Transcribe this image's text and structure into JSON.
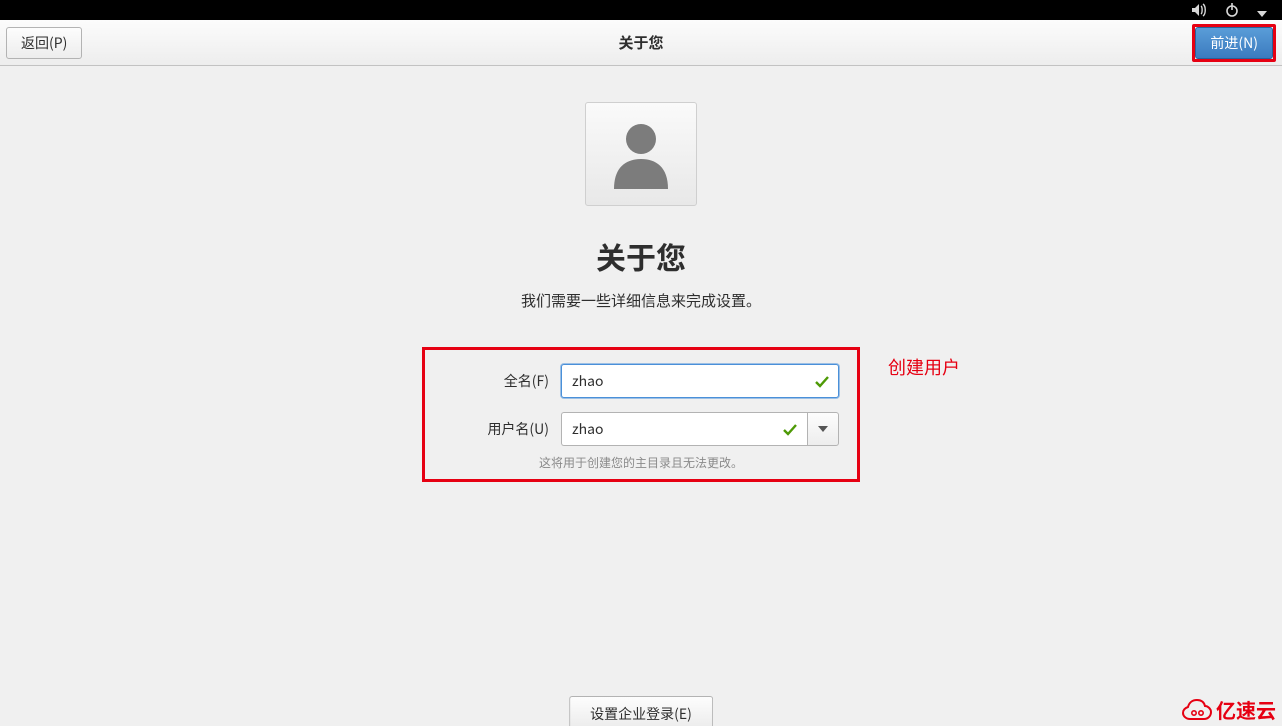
{
  "header": {
    "back_label": "返回(P)",
    "title": "关于您",
    "forward_label": "前进(N)"
  },
  "page": {
    "heading": "关于您",
    "subtitle": "我们需要一些详细信息来完成设置。"
  },
  "form": {
    "fullname_label": "全名(F)",
    "fullname_value": "zhao",
    "username_label": "用户名(U)",
    "username_value": "zhao",
    "helper_text": "这将用于创建您的主目录且无法更改。"
  },
  "annotation": {
    "create_user": "创建用户"
  },
  "footer": {
    "enterprise_label": "设置企业登录(E)"
  },
  "watermark": {
    "text": "亿速云"
  },
  "colors": {
    "highlight": "#e60012",
    "primary": "#4a90d9",
    "valid": "#4e9a06"
  }
}
